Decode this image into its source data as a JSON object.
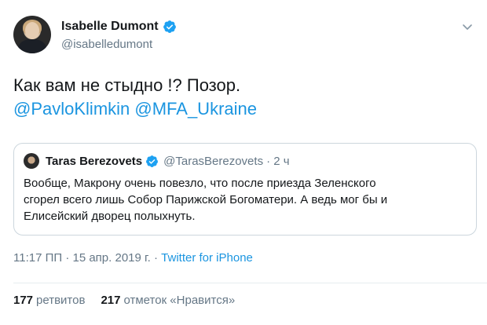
{
  "author": {
    "name": "Isabelle Dumont",
    "handle": "@isabelledumont",
    "verified": true
  },
  "tweet": {
    "line1": "Как вам не стыдно !?  Позор.",
    "mentions": [
      "@PavloKlimkin",
      "@MFA_Ukraine"
    ]
  },
  "quoted": {
    "name": "Taras Berezovets",
    "handle": "@TarasBerezovets",
    "time": "· 2 ч",
    "verified": true,
    "lines": [
      "Вообще, Макрону очень повезло, что после приезда Зеленского",
      "сгорел всего лишь Собор Парижской Богоматери. А ведь мог бы и",
      "Елисейский дворец полыхнуть."
    ]
  },
  "meta": {
    "timestamp": "11:17 ПП · 15 апр. 2019 г. · ",
    "source": "Twitter for iPhone"
  },
  "stats": {
    "retweets_count": "177",
    "retweets_label": "ретвитов",
    "likes_count": "217",
    "likes_label": "отметок «Нравится»"
  },
  "colors": {
    "accent": "#1b95e0",
    "verified": "#1da1f2",
    "secondary_text": "#657786"
  },
  "icons": {
    "verified": "verified-badge-icon",
    "menu": "chevron-down-icon"
  }
}
